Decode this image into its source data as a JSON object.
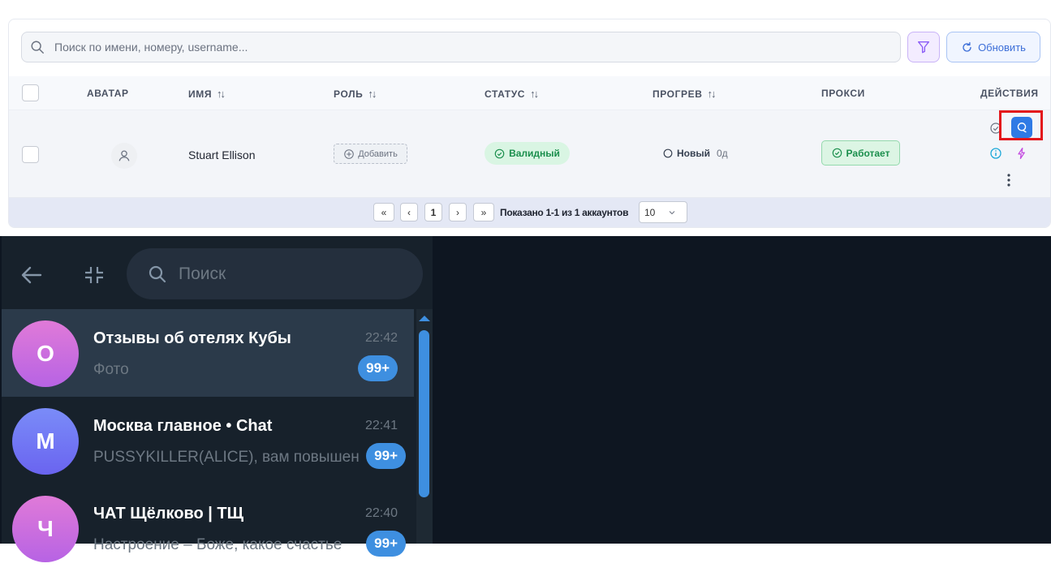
{
  "toolbar": {
    "search_placeholder": "Поиск по имени, номеру, username...",
    "refresh_label": "Обновить"
  },
  "table": {
    "headers": {
      "avatar": "АВАТАР",
      "name": "ИМЯ",
      "role": "РОЛЬ",
      "status": "СТАТУС",
      "warmup": "ПРОГРЕВ",
      "proxy": "ПРОКСИ",
      "actions": "ДЕЙСТВИЯ"
    },
    "rows": [
      {
        "name": "Stuart Ellison",
        "role_button": "Добавить",
        "status": "Валидный",
        "warmup": "Новый",
        "warmup_days": "0д",
        "proxy": "Работает"
      }
    ]
  },
  "pagination": {
    "current_page": "1",
    "info": "Показано 1-1 из 1 аккаунтов",
    "page_size": "10"
  },
  "telegram": {
    "search_placeholder": "Поиск",
    "chats": [
      {
        "initial": "О",
        "title": "Отзывы об отелях Кубы",
        "time": "22:42",
        "message": "Фото",
        "badge": "99+",
        "avatar_color": "#c86ee0"
      },
      {
        "initial": "М",
        "title": "Москва главное • Chat",
        "time": "22:41",
        "message": "PUSSYKILLER(ALICE), вам повышен",
        "badge": "99+",
        "avatar_color": "#6b7ef5"
      },
      {
        "initial": "Ч",
        "title": "ЧАТ Щёлково | ТЩ",
        "time": "22:40",
        "message": "Настроение – Боже, какое счастье",
        "badge": "99+",
        "avatar_color": "#c86ee0"
      }
    ]
  },
  "colors": {
    "accent_blue": "#2f7ae5",
    "status_green": "#1b8f4d",
    "highlight_red": "#e3161b",
    "tg_badge": "#3e8fe0"
  }
}
